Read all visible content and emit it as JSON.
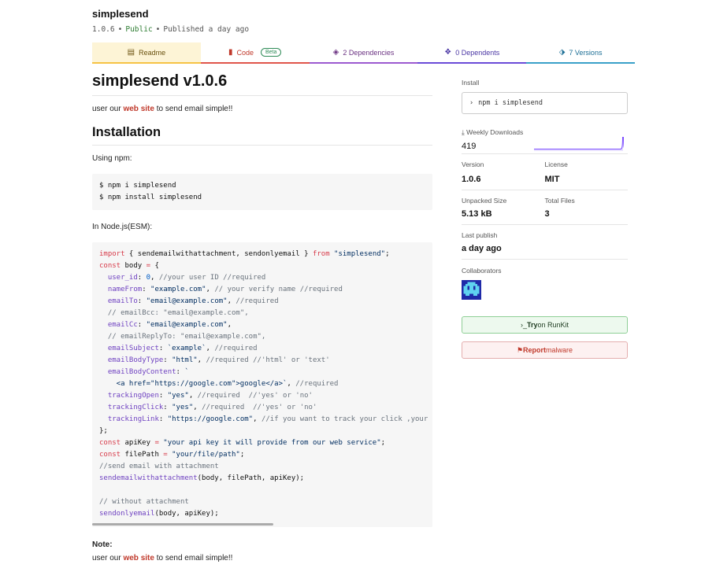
{
  "package": {
    "name": "simplesend",
    "version": "1.0.6",
    "visibility": "Public",
    "published": "Published a day ago"
  },
  "tabs": {
    "readme": "Readme",
    "code": "Code",
    "beta": "Beta",
    "dependencies": "2 Dependencies",
    "dependents": "0 Dependents",
    "versions": "7 Versions"
  },
  "readme": {
    "title": "simplesend v1.0.6",
    "intro_before": "user our ",
    "intro_link": "web site",
    "intro_after": " to send email simple!!",
    "installation_heading": "Installation",
    "using_npm": "Using npm:",
    "install_commands": [
      "$ npm i simplesend",
      "$ npm install simplesend"
    ],
    "in_node": "In Node.js(ESM):",
    "note_label": "Note:",
    "note_before": "user our ",
    "note_link": "web site",
    "note_after": " to send email simple!!"
  },
  "sidebar": {
    "install_label": "Install",
    "install_command": "npm i simplesend",
    "weekly_downloads_label": "Weekly Downloads",
    "weekly_downloads": "419",
    "version_label": "Version",
    "version": "1.0.6",
    "license_label": "License",
    "license": "MIT",
    "unpacked_size_label": "Unpacked Size",
    "unpacked_size": "5.13 kB",
    "total_files_label": "Total Files",
    "total_files": "3",
    "last_publish_label": "Last publish",
    "last_publish": "a day ago",
    "collaborators_label": "Collaborators",
    "runkit_label_bold": "Try",
    "runkit_label_rest": " on RunKit",
    "report_bold": "Report",
    "report_rest": " malware"
  },
  "colors": {
    "accent_red": "#c0392b",
    "sparkline": "#7c4dff"
  }
}
